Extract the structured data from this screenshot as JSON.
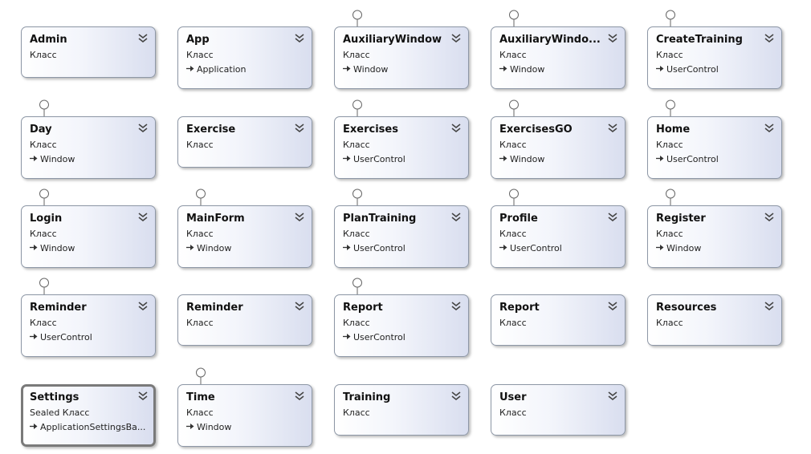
{
  "diagram": {
    "classes": [
      {
        "name": "Admin",
        "stereotype": "Класс",
        "base": "",
        "interface": false,
        "selected": false
      },
      {
        "name": "App",
        "stereotype": "Класс",
        "base": "Application",
        "interface": false,
        "selected": false
      },
      {
        "name": "AuxiliaryWindow",
        "stereotype": "Класс",
        "base": "Window",
        "interface": true,
        "selected": false
      },
      {
        "name": "AuxiliaryWindo...",
        "stereotype": "Класс",
        "base": "Window",
        "interface": true,
        "selected": false
      },
      {
        "name": "CreateTraining",
        "stereotype": "Класс",
        "base": "UserControl",
        "interface": true,
        "selected": false
      },
      {
        "name": "Day",
        "stereotype": "Класс",
        "base": "Window",
        "interface": true,
        "selected": false
      },
      {
        "name": "Exercise",
        "stereotype": "Класс",
        "base": "",
        "interface": false,
        "selected": false
      },
      {
        "name": "Exercises",
        "stereotype": "Класс",
        "base": "UserControl",
        "interface": true,
        "selected": false
      },
      {
        "name": "ExercisesGO",
        "stereotype": "Класс",
        "base": "Window",
        "interface": true,
        "selected": false
      },
      {
        "name": "Home",
        "stereotype": "Класс",
        "base": "UserControl",
        "interface": true,
        "selected": false
      },
      {
        "name": "Login",
        "stereotype": "Класс",
        "base": "Window",
        "interface": true,
        "selected": false
      },
      {
        "name": "MainForm",
        "stereotype": "Класс",
        "base": "Window",
        "interface": true,
        "selected": false
      },
      {
        "name": "PlanTraining",
        "stereotype": "Класс",
        "base": "UserControl",
        "interface": true,
        "selected": false
      },
      {
        "name": "Profile",
        "stereotype": "Класс",
        "base": "UserControl",
        "interface": true,
        "selected": false
      },
      {
        "name": "Register",
        "stereotype": "Класс",
        "base": "Window",
        "interface": true,
        "selected": false
      },
      {
        "name": "Reminder",
        "stereotype": "Класс",
        "base": "UserControl",
        "interface": true,
        "selected": false
      },
      {
        "name": "Reminder",
        "stereotype": "Класс",
        "base": "",
        "interface": false,
        "selected": false
      },
      {
        "name": "Report",
        "stereotype": "Класс",
        "base": "UserControl",
        "interface": true,
        "selected": false
      },
      {
        "name": "Report",
        "stereotype": "Класс",
        "base": "",
        "interface": false,
        "selected": false
      },
      {
        "name": "Resources",
        "stereotype": "Класс",
        "base": "",
        "interface": false,
        "selected": false
      },
      {
        "name": "Settings",
        "stereotype": "Sealed Класс",
        "base": "ApplicationSettingsBa...",
        "interface": false,
        "selected": true
      },
      {
        "name": "Time",
        "stereotype": "Класс",
        "base": "Window",
        "interface": true,
        "selected": false
      },
      {
        "name": "Training",
        "stereotype": "Класс",
        "base": "",
        "interface": false,
        "selected": false
      },
      {
        "name": "User",
        "stereotype": "Класс",
        "base": "",
        "interface": false,
        "selected": false
      }
    ],
    "colors": {
      "card_gradient_end": "#d9deef",
      "card_border": "#8d97a6",
      "selected_border": "#7a7a7a"
    },
    "icons": {
      "collapse": "chevron-double-down-icon",
      "inheritance": "inheritance-arrow-icon",
      "interface": "interface-lollipop-icon"
    }
  }
}
